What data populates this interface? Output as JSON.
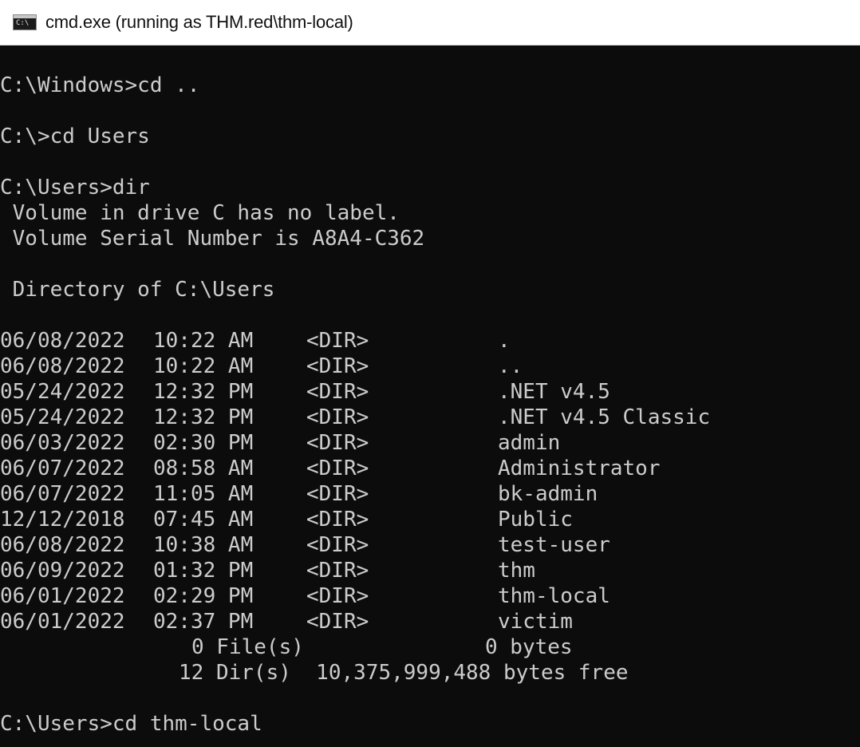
{
  "window": {
    "title": "cmd.exe (running as THM.red\\thm-local)",
    "icon_glyph": "C:\\"
  },
  "console": {
    "cmd1": "C:\\Windows>cd ..",
    "cmd2": "C:\\>cd Users",
    "cmd3": "C:\\Users>dir",
    "volume_label": " Volume in drive C has no label.",
    "volume_serial": " Volume Serial Number is A8A4-C362",
    "directory_of": " Directory of C:\\Users",
    "entries": [
      {
        "date": "06/08/2022",
        "time": "10:22 AM",
        "type": "<DIR>",
        "name": "."
      },
      {
        "date": "06/08/2022",
        "time": "10:22 AM",
        "type": "<DIR>",
        "name": ".."
      },
      {
        "date": "05/24/2022",
        "time": "12:32 PM",
        "type": "<DIR>",
        "name": ".NET v4.5"
      },
      {
        "date": "05/24/2022",
        "time": "12:32 PM",
        "type": "<DIR>",
        "name": ".NET v4.5 Classic"
      },
      {
        "date": "06/03/2022",
        "time": "02:30 PM",
        "type": "<DIR>",
        "name": "admin"
      },
      {
        "date": "06/07/2022",
        "time": "08:58 AM",
        "type": "<DIR>",
        "name": "Administrator"
      },
      {
        "date": "06/07/2022",
        "time": "11:05 AM",
        "type": "<DIR>",
        "name": "bk-admin"
      },
      {
        "date": "12/12/2018",
        "time": "07:45 AM",
        "type": "<DIR>",
        "name": "Public"
      },
      {
        "date": "06/08/2022",
        "time": "10:38 AM",
        "type": "<DIR>",
        "name": "test-user"
      },
      {
        "date": "06/09/2022",
        "time": "01:32 PM",
        "type": "<DIR>",
        "name": "thm"
      },
      {
        "date": "06/01/2022",
        "time": "02:29 PM",
        "type": "<DIR>",
        "name": "thm-local"
      },
      {
        "date": "06/01/2022",
        "time": "02:37 PM",
        "type": "<DIR>",
        "name": "victim"
      }
    ],
    "files_summary": "0 File(s)",
    "files_bytes": "0 bytes",
    "dirs_summary": "12 Dir(s)  10,375,999,488 bytes free",
    "cmd4": "C:\\Users>cd thm-local"
  }
}
